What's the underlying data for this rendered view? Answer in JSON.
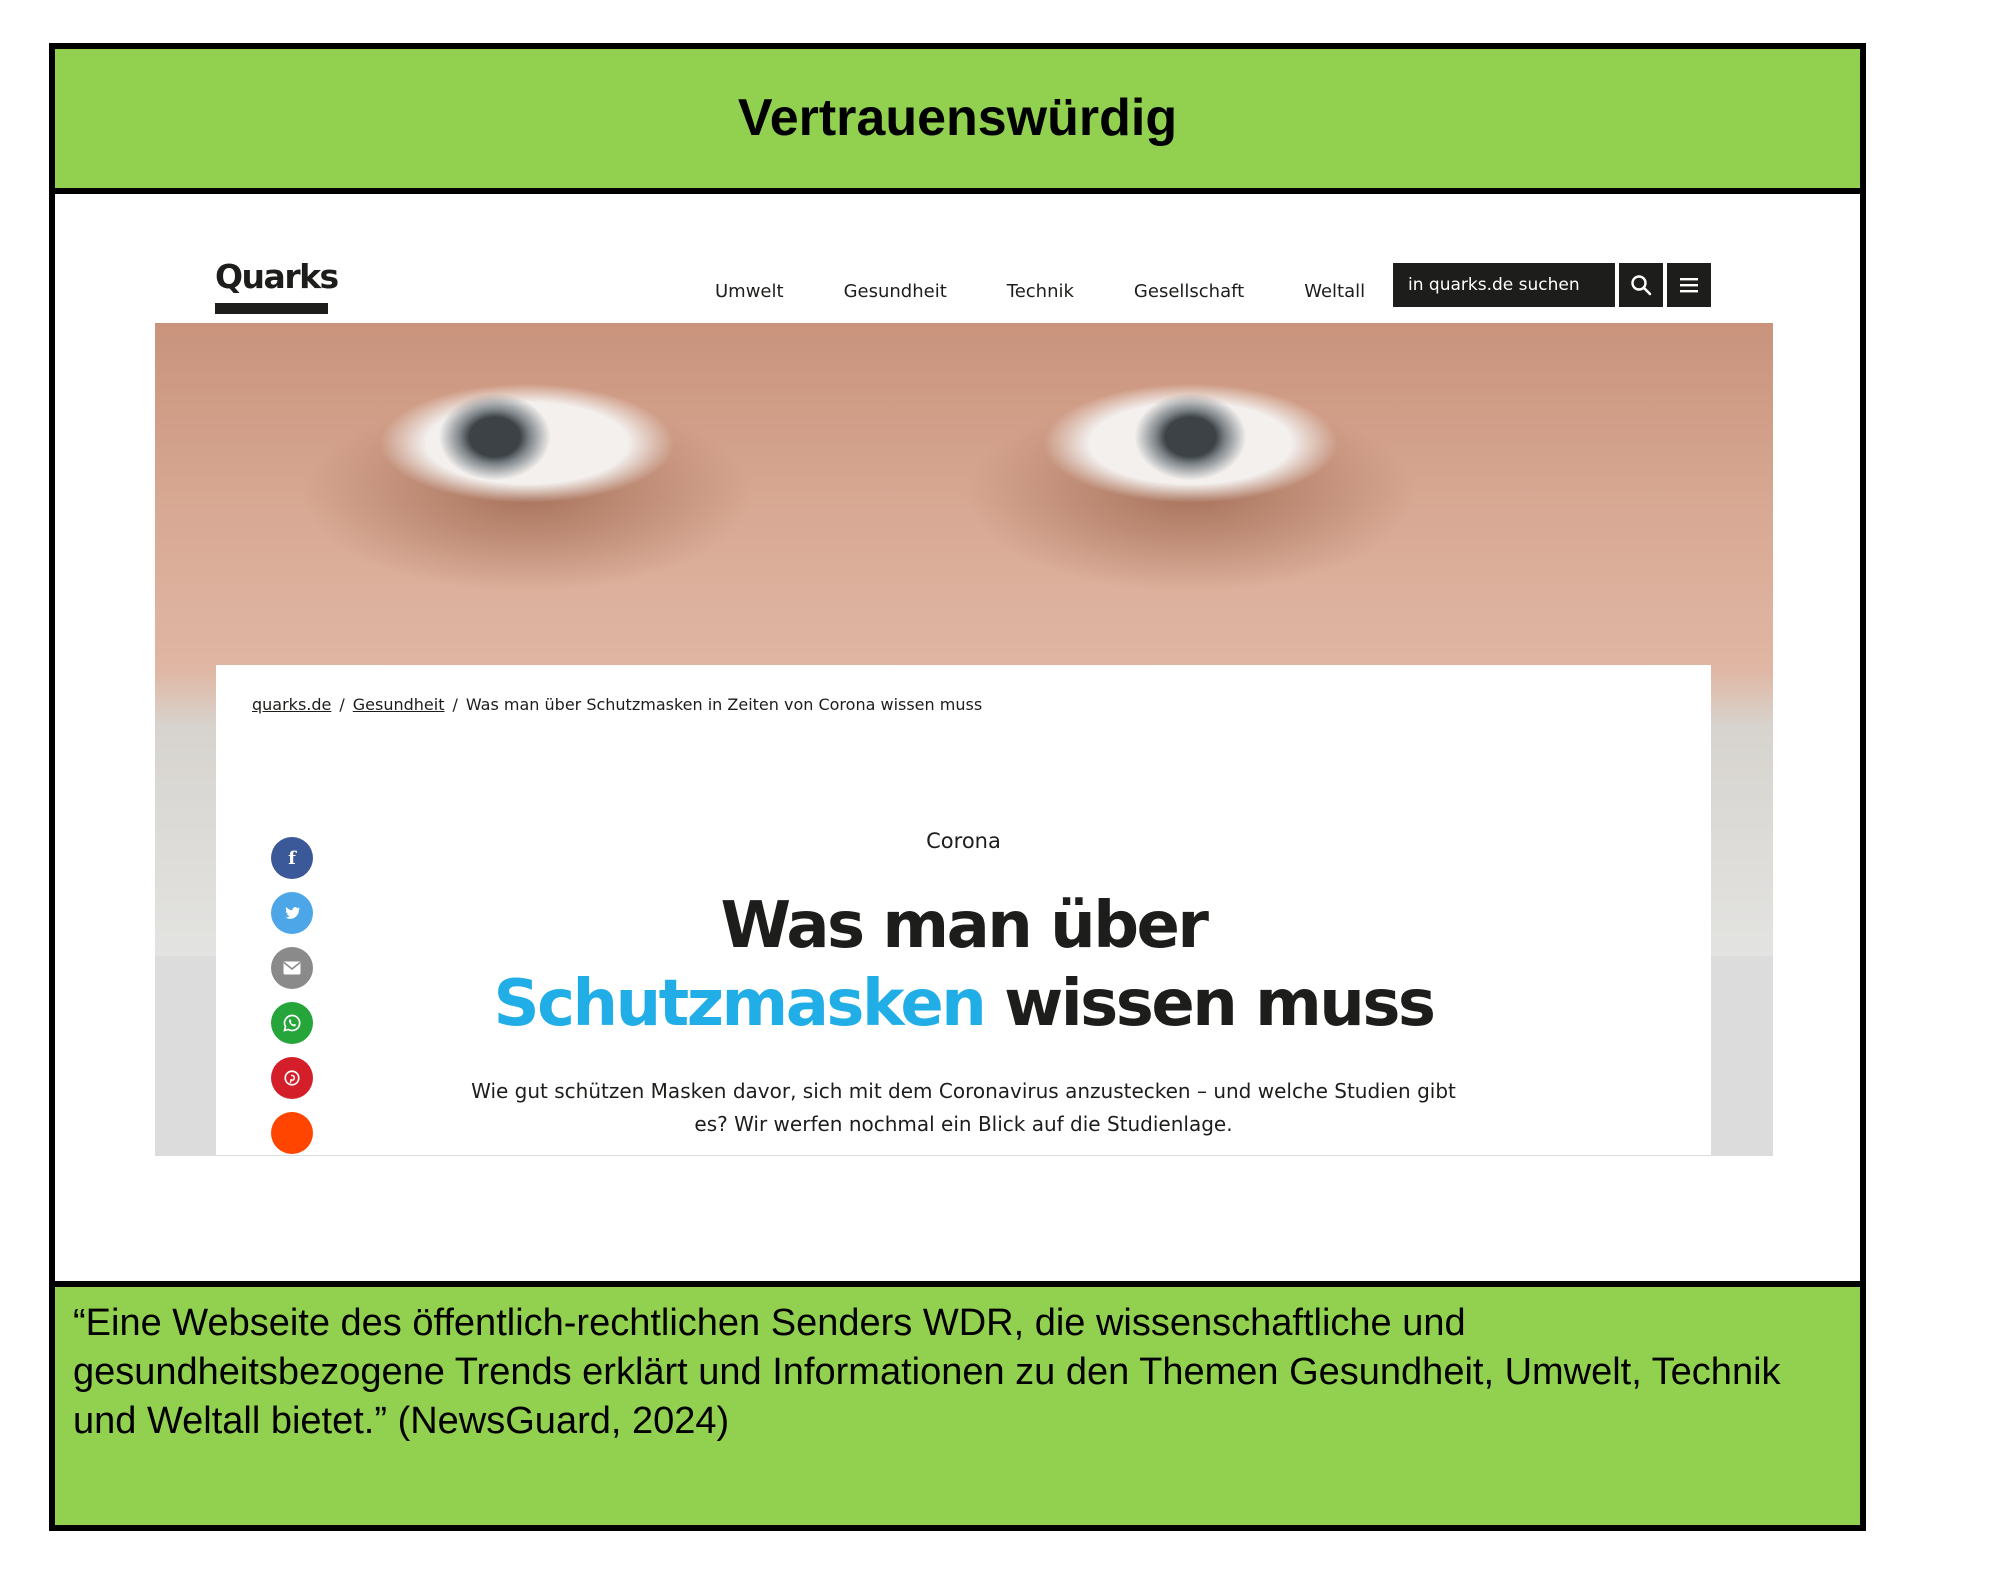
{
  "colors": {
    "accent_green": "#92d050",
    "accent_blue": "#21aee6",
    "facebook": "#3b5998",
    "twitter": "#4da6e8",
    "email": "#8a8a8a",
    "whatsapp": "#25a53a",
    "pinterest": "#d41f2a",
    "reddit": "#ff4500"
  },
  "label": {
    "title": "Vertrauenswürdig"
  },
  "citation": {
    "text": "“Eine Webseite des öffentlich-rechtlichen Senders WDR, die wissenschaftliche und gesundheitsbezogene Trends erklärt und Informationen zu den Themen Gesundheit, Umwelt, Technik und Weltall bietet.” (NewsGuard, 2024)"
  },
  "site": {
    "logo": "Quarks",
    "nav": [
      "Umwelt",
      "Gesundheit",
      "Technik",
      "Gesellschaft",
      "Weltall"
    ],
    "search_placeholder": "in quarks.de suchen",
    "search_icon": "search-icon",
    "menu_icon": "hamburger-menu-icon"
  },
  "breadcrumb": {
    "home": "quarks.de",
    "section": "Gesundheit",
    "current": "Was man über Schutzmasken in Zeiten von Corona wissen muss",
    "separator": "/"
  },
  "article": {
    "kicker": "Corona",
    "headline_line1": "Was man über",
    "headline_highlight": "Schutzmasken",
    "headline_rest": " wissen muss",
    "lead": "Wie gut schützen Masken davor, sich mit dem Coronavirus anzustecken – und welche Studien gibt es? Wir werfen nochmal ein Blick auf die Studienlage."
  },
  "share": [
    {
      "name": "facebook-share-button",
      "icon": "facebook-icon",
      "glyph": "f",
      "color_key": "facebook"
    },
    {
      "name": "twitter-share-button",
      "icon": "twitter-icon",
      "glyph": "",
      "color_key": "twitter"
    },
    {
      "name": "email-share-button",
      "icon": "envelope-icon",
      "glyph": "",
      "color_key": "email"
    },
    {
      "name": "whatsapp-share-button",
      "icon": "whatsapp-icon",
      "glyph": "",
      "color_key": "whatsapp"
    },
    {
      "name": "pinterest-share-button",
      "icon": "pinterest-icon",
      "glyph": "",
      "color_key": "pinterest"
    },
    {
      "name": "reddit-share-button",
      "icon": "reddit-icon",
      "glyph": "",
      "color_key": "reddit"
    }
  ]
}
